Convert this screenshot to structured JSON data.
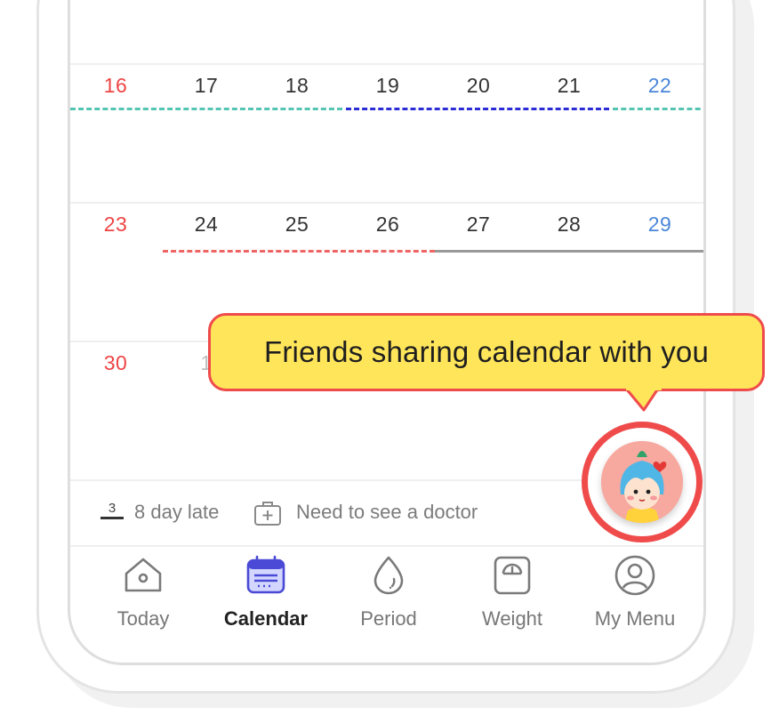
{
  "calendar": {
    "weeks": [
      {
        "days": [
          "16",
          "17",
          "18",
          "19",
          "20",
          "21",
          "22"
        ]
      },
      {
        "days": [
          "23",
          "24",
          "25",
          "26",
          "27",
          "28",
          "29"
        ]
      },
      {
        "days": [
          "30",
          "1"
        ]
      }
    ]
  },
  "legend": {
    "late_marker": "3",
    "late_label": "8 day late",
    "doctor_label": "Need to see a doctor"
  },
  "tabs": [
    {
      "label": "Today",
      "icon": "home-icon"
    },
    {
      "label": "Calendar",
      "icon": "calendar-icon"
    },
    {
      "label": "Period",
      "icon": "drop-icon"
    },
    {
      "label": "Weight",
      "icon": "scale-icon"
    },
    {
      "label": "My Menu",
      "icon": "user-icon"
    }
  ],
  "tooltip": {
    "text": "Friends sharing calendar with you"
  },
  "colors": {
    "accent": "#ef4b4b",
    "tooltip_bg": "#ffe55a",
    "active_tab": "#4a4ad6",
    "sunday": "#ee4444",
    "saturday": "#4a86d9"
  }
}
